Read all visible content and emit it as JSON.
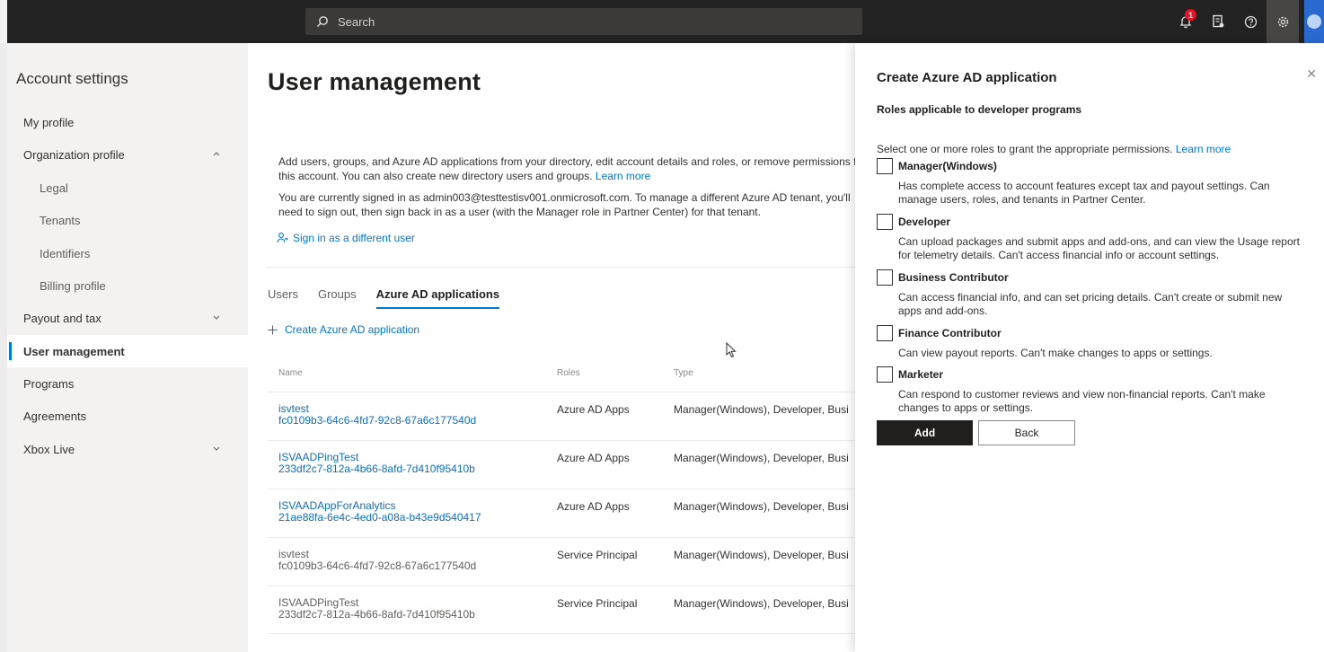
{
  "topbar": {
    "search_placeholder": "Search",
    "notification_count": "1"
  },
  "nav": {
    "title": "Account settings",
    "items": [
      {
        "label": "My profile"
      },
      {
        "label": "Organization profile"
      },
      {
        "label": "Legal"
      },
      {
        "label": "Tenants"
      },
      {
        "label": "Identifiers"
      },
      {
        "label": "Billing profile"
      },
      {
        "label": "Payout and tax"
      },
      {
        "label": "User management"
      },
      {
        "label": "Programs"
      },
      {
        "label": "Agreements"
      },
      {
        "label": "Xbox Live"
      }
    ]
  },
  "main": {
    "title": "User management",
    "info1": "Add users, groups, and Azure AD applications from your directory, edit account details and roles, or remove permissions for this account. You can also create new directory users and groups.",
    "learn_more": "Learn more",
    "info2": "You are currently signed in as admin003@testtestisv001.onmicrosoft.com. To manage a different Azure AD tenant, you'll need to sign out, then sign back in as a user (with the Manager role in Partner Center) for that tenant.",
    "signin": "Sign in as a different user",
    "tabs": [
      {
        "label": "Users"
      },
      {
        "label": "Groups"
      },
      {
        "label": "Azure AD applications"
      }
    ],
    "create_link": "Create Azure AD application",
    "columns": {
      "name": "Name",
      "roles": "Roles",
      "type": "Type"
    },
    "rows": [
      {
        "name": "isvtest",
        "id": "fc0109b3-64c6-4fd7-92c8-67a6c177540d",
        "role": "Azure AD Apps",
        "type": "Manager(Windows), Developer, Busi"
      },
      {
        "name": "ISVAADPingTest",
        "id": "233df2c7-812a-4b66-8afd-7d410f95410b",
        "role": "Azure AD Apps",
        "type": "Manager(Windows), Developer, Busi"
      },
      {
        "name": "ISVAADAppForAnalytics",
        "id": "21ae88fa-6e4c-4ed0-a08a-b43e9d540417",
        "role": "Azure AD Apps",
        "type": "Manager(Windows), Developer, Busi"
      },
      {
        "name": "isvtest",
        "id": "fc0109b3-64c6-4fd7-92c8-67a6c177540d",
        "role": "Service Principal",
        "type": "Manager(Windows), Developer, Busi"
      },
      {
        "name": "ISVAADPingTest",
        "id": "233df2c7-812a-4b66-8afd-7d410f95410b",
        "role": "Service Principal",
        "type": "Manager(Windows), Developer, Busi"
      }
    ]
  },
  "panel": {
    "title": "Create Azure AD application",
    "subtitle": "Roles applicable to developer programs",
    "intro": "Select one or more roles to grant the appropriate permissions.",
    "learn_more": "Learn more",
    "roles": [
      {
        "label": "Manager(Windows)",
        "desc": "Has complete access to account features except tax and payout settings. Can manage users, roles, and tenants in Partner Center."
      },
      {
        "label": "Developer",
        "desc": "Can upload packages and submit apps and add-ons, and can view the Usage report for telemetry details. Can't access financial info or account settings."
      },
      {
        "label": "Business Contributor",
        "desc": "Can access financial info, and can set pricing details. Can't create or submit new apps and add-ons."
      },
      {
        "label": "Finance Contributor",
        "desc": "Can view payout reports. Can't make changes to apps or settings."
      },
      {
        "label": "Marketer",
        "desc": "Can respond to customer reviews and view non-financial reports. Can't make changes to apps or settings."
      }
    ],
    "add_label": "Add",
    "back_label": "Back"
  }
}
